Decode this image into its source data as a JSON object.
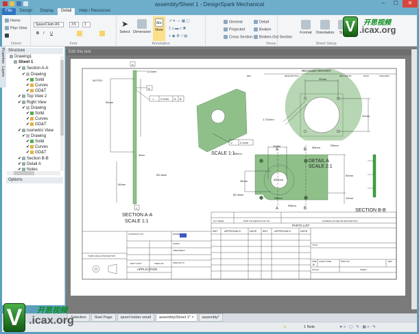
{
  "window": {
    "title": "assembly/Sheet 1 - DesignSpark Mechanical",
    "minimize": "–",
    "maximize": "☐",
    "close": "✕"
  },
  "tabs": [
    "File",
    "Design",
    "Display",
    "Detail",
    "Help / Resources"
  ],
  "ribbon": {
    "orient": {
      "label": "Orient",
      "home": "Home",
      "plan_view": "Plan View"
    },
    "font": {
      "label": "Font",
      "family": "SpaceClaim AS",
      "size": "3.5",
      "scale": "1",
      "bold": "B",
      "italic": "I",
      "underline": "U"
    },
    "tools": {
      "select": "Select",
      "dimension": "Dimension",
      "note": "Note",
      "note_icon": "Abc"
    },
    "annotation_label": "Annotation",
    "views": {
      "label": "Views",
      "items": [
        "General",
        "Projected",
        "Cross Section",
        "Detail",
        "Broken",
        "Broken-Out Section"
      ]
    },
    "sheet_setup": {
      "label": "Sheet Setup",
      "format": "Format",
      "orientation": "Orientation",
      "size": "Size"
    }
  },
  "structure": {
    "title": "Structure",
    "items": [
      {
        "label": "Drawing1",
        "level": 0
      },
      {
        "label": "Sheet 1",
        "level": 1
      },
      {
        "label": "Section A-A",
        "level": 2
      },
      {
        "label": "Drawing",
        "level": 3
      },
      {
        "label": "Solid",
        "level": 4
      },
      {
        "label": "Curves",
        "level": 4
      },
      {
        "label": "GD&T",
        "level": 4
      },
      {
        "label": "Top View 2",
        "level": 2
      },
      {
        "label": "Right View",
        "level": 2
      },
      {
        "label": "Drawing",
        "level": 3
      },
      {
        "label": "Solid",
        "level": 4
      },
      {
        "label": "Curves",
        "level": 4
      },
      {
        "label": "GD&T",
        "level": 4
      },
      {
        "label": "Isometric View",
        "level": 2
      },
      {
        "label": "Drawing",
        "level": 3
      },
      {
        "label": "Solid",
        "level": 4
      },
      {
        "label": "Curves",
        "level": 4
      },
      {
        "label": "GD&T",
        "level": 4
      },
      {
        "label": "Section B-B",
        "level": 2
      },
      {
        "label": "Detail A",
        "level": 2
      },
      {
        "label": "Notes",
        "level": 2
      }
    ],
    "side_tabs": [
      "Properties",
      "Layers"
    ]
  },
  "options": {
    "title": "Options"
  },
  "canvas": {
    "header": "Edit this text",
    "sheet_color": "#ffffff",
    "part_color": "#8fc08a"
  },
  "drawing": {
    "notes": "NOTES:",
    "dim_95": "95mm",
    "dim_13_5": "13.5mm",
    "datum_a": "A",
    "datum_b": "B",
    "datum_c": "C",
    "tol_perp": "⊥",
    "tol_perp_val": "0.2mm",
    "dim_3": "3mm",
    "dim_50": "50mm",
    "dim_d1_8": "Ø1.8mm",
    "section_aa": "SECTION A-A",
    "scale_11": "SCALE 1:1",
    "flat_sym": "▱",
    "flat_val": "0.1mm",
    "iso_scale": "SCALE 1:1",
    "revision_history": "REVISION HISTORY",
    "rev_cols": [
      "REV",
      "DESCRIPTION",
      "RECORD BY",
      "DATE",
      "CHECKED"
    ],
    "rv_20a": "20mm",
    "rv_20b": "20mm",
    "rv_1742": "1.742mm",
    "fv_26a": "26mm",
    "fv_26b": "26mm",
    "fv_d3": "Ø3mm",
    "fv_r5a": "R5mm",
    "fv_r5b": "R5mm",
    "fv_r5c": "R5mm",
    "fv_r5d": "R5mm",
    "fv_d23": "Ø23mm",
    "fv_d18": "Ø1.8mm",
    "fv_50": "50mm",
    "fv_10": "10mm",
    "detail_a": "DETAIL A",
    "scale_21": "SCALE 2:1",
    "sec_a": "A",
    "sec_b": "B",
    "section_bb": "SECTION B-B"
  },
  "title_block": {
    "parts_list": "PARTS LIST",
    "part_no": "PART OR IDENTIFYING NO.",
    "nomenclature": "NOMENCLATURE OR DESCRIPTION",
    "qty": "QTY REQD",
    "item": "ITEM NO",
    "approvals_cols": [
      "INIT",
      "APPROVALS",
      "DATE",
      "INIT",
      "APPROVALS",
      "DATE"
    ],
    "title": "TITLE",
    "size": "SIZE",
    "size_val": "B",
    "cage": "CAGE CODE",
    "dwg": "DWG NO",
    "rev": "REV",
    "scale": "SCALE",
    "sheet": "SHEET",
    "contract": "CONTRACT NO.",
    "material": "MATERIAL",
    "finish": "FINISH",
    "treatment": "TREATMENT",
    "similar": "SIMILAR TO",
    "next_assy": "NEXT ASSY",
    "used_on": "USED ON",
    "application": "APPLICATION",
    "projection": "THIRD ANGLE PROJECTION"
  },
  "doc_tabs": [
    "Selection",
    "Start Page",
    "spool holder small",
    "assembly/Sheet 1* ×",
    "assembly*"
  ],
  "status": {
    "selection": "1 Note",
    "warning": "⚠"
  },
  "watermark": {
    "v": "V",
    "cn": "开思视频",
    "site": ".icax.org"
  }
}
